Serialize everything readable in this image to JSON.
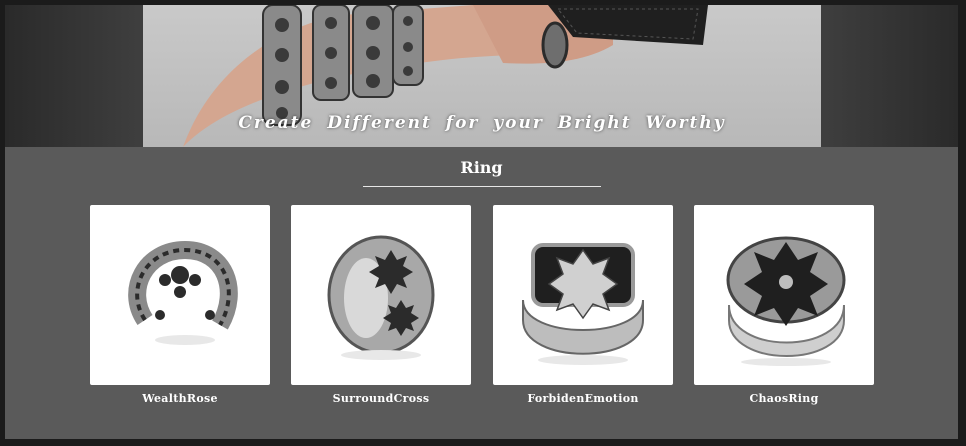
{
  "hero": {
    "tagline": "Create Different for your Bright Worthy",
    "image_icon": "bracelet-wrist-photo"
  },
  "section": {
    "title": "Ring"
  },
  "products": [
    {
      "name": "WealthRose",
      "icon": "wealthrose-ring-image"
    },
    {
      "name": "SurroundCross",
      "icon": "surroundcross-ring-image"
    },
    {
      "name": "ForbidenEmotion",
      "icon": "forbidenemotion-ring-image"
    },
    {
      "name": "ChaosRing",
      "icon": "chaosring-ring-image"
    }
  ],
  "colors": {
    "page_bg": "#5a5a5a",
    "hero_bg": "#3e3e3e",
    "text": "#ffffff",
    "card_bg": "#ffffff"
  }
}
